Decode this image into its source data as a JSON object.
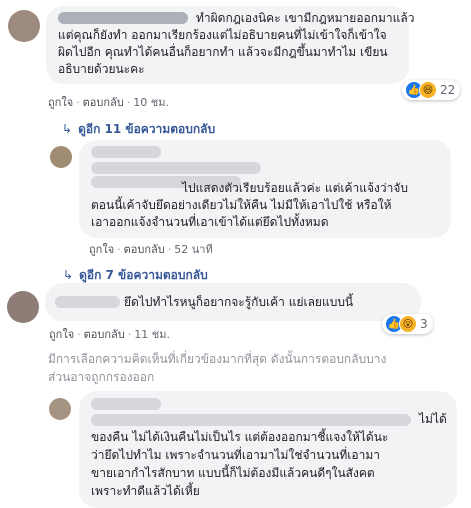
{
  "comments": [
    {
      "text_lines": [
        "ทำผิดกฎเองนิคะ เขามีกฎหมายออกมาแล้ว",
        "แต่คุณก็ยังทำ ออกมาเรียกร้องแต่ไม่อธิบายคนที่ไม่เข้าใจก็เข้าใจ",
        "ผิดไปอีก คุณทำได้คนอื่นก็อยากทำ แล้วจะมีกฎขึ้นมาทำไม เขียน",
        "อธิบายด้วยนะคะ"
      ],
      "like_label": "ถูกใจ",
      "reply_label": "ตอบกลับ",
      "time": "10 ชม.",
      "reaction_count": "22",
      "replies_label": "ดูอีก 11 ข้อความตอบกลับ"
    },
    {
      "text_lines": [
        "ไปแสดงตัวเรียบร้อยแล้วค่ะ แต่เค้าแจ้งว่าจับ",
        "ตอนนี้เค้าจับยึดอย่างเดียวไม่ให้คืน ไม่มีให้เอาไปใช้ หรือให้",
        "เอาออกแจ้งจำนวนที่เอาเข้าได้แต่ยึดไปทั้งหมด"
      ],
      "like_label": "ถูกใจ",
      "reply_label": "ตอบกลับ",
      "time": "52 นาที",
      "replies_label": "ดูอีก 7 ข้อความตอบกลับ"
    },
    {
      "text_lines": [
        "ยึดไปทำไรหนูก็อยากจะรู้กับเค้า แย่เลยแบบนี้"
      ],
      "like_label": "ถูกใจ",
      "reply_label": "ตอบกลับ",
      "time": "11 ชม.",
      "reaction_count": "3"
    },
    {
      "text_lines": [
        "ไม่ได้",
        "ของคืน ไม่ได้เงินคืนไม่เป็นไร แต่ต้องออกมาชี้แจงให้ได้นะ",
        "ว่ายึดไปทำไม เพราะจำนวนที่เอามาไม่ใช่จำนวนที่เอามา",
        "ขายเอากำไรสักบาท แบบนี้ก็ไม่ต้องมีแล้วคนดีๆในสังคต",
        "เพราะทำดีแล้วได้เหี้ย"
      ]
    }
  ],
  "filter_note": [
    "มีการเลือกความคิดเห็นที่เกี่ยวข้องมากที่สุด ดังนั้นการตอบกลับบาง",
    "ส่วนอาจถูกกรองออก"
  ],
  "icons": {
    "like": "thumbs-up-icon",
    "haha": "laughing-face-icon",
    "wow": "surprised-face-icon",
    "reply_arrow": "reply-arrow-icon"
  },
  "colors": {
    "link": "#385898",
    "bubble": "#f2f3f5",
    "meta": "#606770",
    "like_blue": "#1877f2"
  }
}
